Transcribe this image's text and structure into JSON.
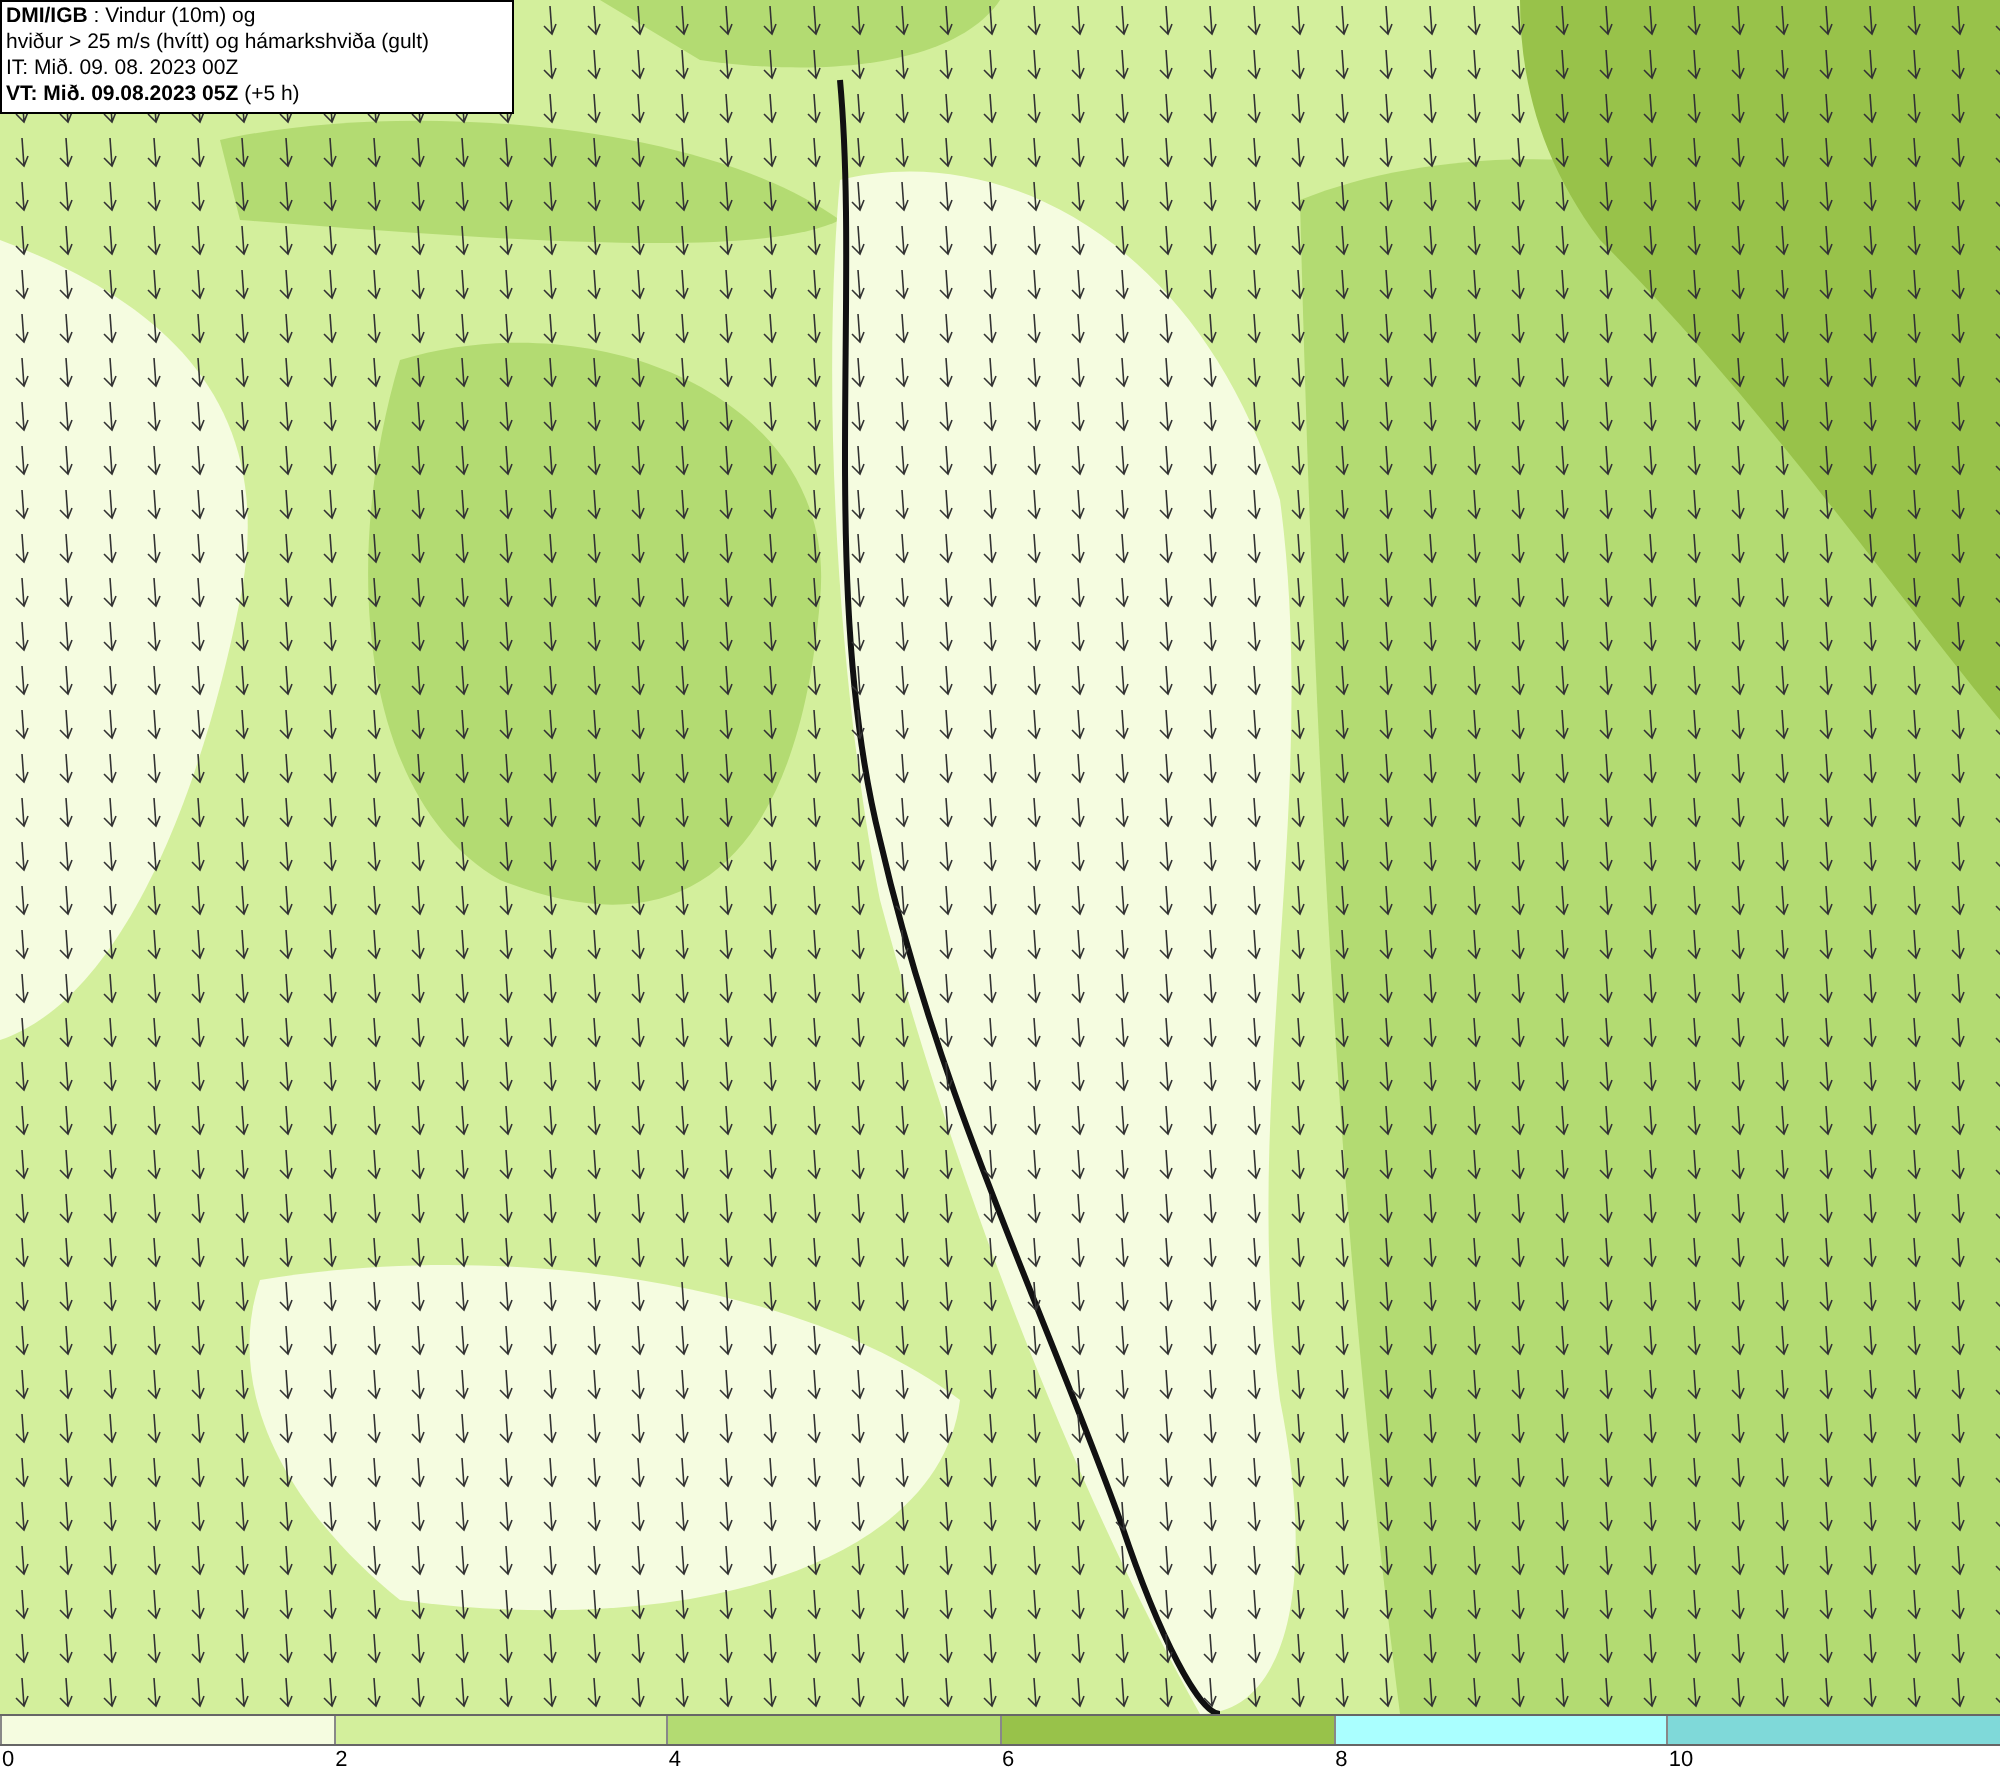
{
  "title_box": {
    "lines": [
      "**DMI/IGB** : Vindur (10m) og",
      "hviður > 25 m/s (hvítt) og hámarkshviða (gult)",
      "IT: Mið. 09. 08. 2023 00Z",
      "**VT: Mið. 09.08.2023 05Z** (+5 h)"
    ]
  },
  "legend": {
    "bands": [
      {
        "color": "#f5fce0"
      },
      {
        "color": "#d3ef9c"
      },
      {
        "color": "#b3db72"
      },
      {
        "color": "#98c24a"
      },
      {
        "color": "#aaffff"
      },
      {
        "color": "#7fd9d9"
      }
    ],
    "ticks": [
      "0",
      "2",
      "4",
      "6",
      "8",
      "10"
    ]
  }
}
